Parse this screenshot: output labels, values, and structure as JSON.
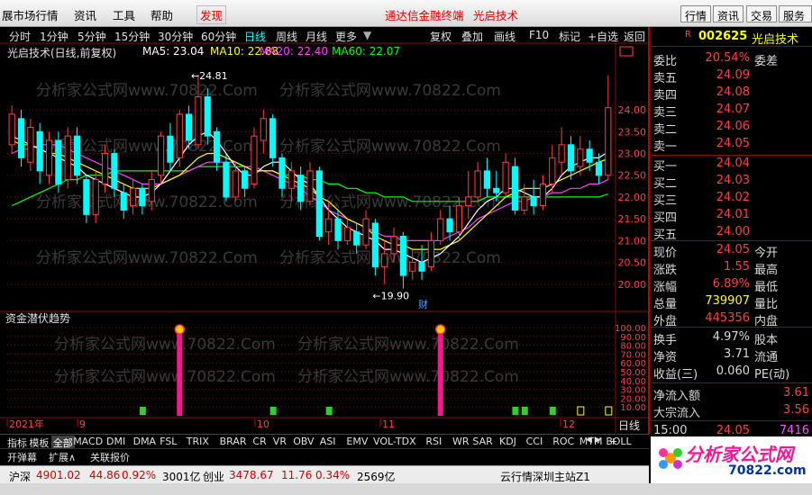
{
  "menu": {
    "items": [
      "展市场行情",
      "资讯",
      "工具",
      "帮助"
    ],
    "discover": "发现",
    "promo": [
      "通达信金融终端",
      "光启技术"
    ],
    "buttons": [
      "行情",
      "资讯",
      "交易"
    ],
    "more_btn": "服务"
  },
  "toolbar": {
    "periods": [
      "分时",
      "1分钟",
      "5分钟",
      "15分钟",
      "30分钟",
      "60分钟",
      "日线",
      "周线",
      "月线",
      "更多"
    ],
    "active": "日线",
    "tools": [
      "复权",
      "叠加",
      "画线",
      "F10",
      "标记",
      "+自选",
      "返回"
    ]
  },
  "chart_header": {
    "name": "光启技术(日线,前复权)",
    "ma5": "MA5: 23.04",
    "ma10": "MA10: 22.88",
    "ma20": "MA20: 22.40",
    "ma60": "MA60: 22.07"
  },
  "colors": {
    "up": "#ff4040",
    "down": "#00ffff",
    "ma5": "#ffffff",
    "ma10": "#ffff00",
    "ma20": "#ff40ff",
    "ma60": "#00ff00",
    "grid": "#801010",
    "indicator": "#ff1493"
  },
  "chart_data": {
    "type": "candlestick",
    "price_axis": [
      "24.00",
      "23.50",
      "23.00",
      "22.50",
      "22.00",
      "21.50",
      "21.00",
      "20.50",
      "20.00"
    ],
    "ylim": [
      19.5,
      25.2
    ],
    "high_label": "24.81",
    "low_label": "19.90",
    "event_marker": "财",
    "date_labels": [
      "2021年",
      "9",
      "10",
      "11",
      "12"
    ],
    "period_label": "日线",
    "candles": [
      [
        23.2,
        23.9,
        23.0,
        24.1
      ],
      [
        23.8,
        22.9,
        22.7,
        24.0
      ],
      [
        22.8,
        23.6,
        22.6,
        23.8
      ],
      [
        23.5,
        22.6,
        22.3,
        23.7
      ],
      [
        22.5,
        23.3,
        22.3,
        23.5
      ],
      [
        23.3,
        22.3,
        22.1,
        23.5
      ],
      [
        22.4,
        23.4,
        22.2,
        23.6
      ],
      [
        23.4,
        22.5,
        22.3,
        23.6
      ],
      [
        22.4,
        21.6,
        21.4,
        22.5
      ],
      [
        21.6,
        22.4,
        21.4,
        22.6
      ],
      [
        22.3,
        23.0,
        22.1,
        23.2
      ],
      [
        23.0,
        22.2,
        22.0,
        23.1
      ],
      [
        22.1,
        21.7,
        21.5,
        22.3
      ],
      [
        21.8,
        22.2,
        21.6,
        22.4
      ],
      [
        22.2,
        21.8,
        21.6,
        22.3
      ],
      [
        21.9,
        22.4,
        21.7,
        22.6
      ],
      [
        22.5,
        23.4,
        22.3,
        23.5
      ],
      [
        23.4,
        22.8,
        22.6,
        23.7
      ],
      [
        22.9,
        23.9,
        22.7,
        24.0
      ],
      [
        23.9,
        23.3,
        23.1,
        24.1
      ],
      [
        23.2,
        24.3,
        23.1,
        24.81
      ],
      [
        24.3,
        23.4,
        23.2,
        24.5
      ],
      [
        23.5,
        22.8,
        22.6,
        23.6
      ],
      [
        22.8,
        22.0,
        21.9,
        23.0
      ],
      [
        22.0,
        22.6,
        21.9,
        22.8
      ],
      [
        22.6,
        22.2,
        22.0,
        22.7
      ],
      [
        22.3,
        23.4,
        22.2,
        23.6
      ],
      [
        23.3,
        23.8,
        23.0,
        24.0
      ],
      [
        23.8,
        22.9,
        22.7,
        23.9
      ],
      [
        22.9,
        22.2,
        22.0,
        23.0
      ],
      [
        22.2,
        22.6,
        21.9,
        22.8
      ],
      [
        22.5,
        21.9,
        21.7,
        22.7
      ],
      [
        21.9,
        22.6,
        21.8,
        22.8
      ],
      [
        22.6,
        21.1,
        21.0,
        22.7
      ],
      [
        21.2,
        21.5,
        20.9,
        21.9
      ],
      [
        21.5,
        21.0,
        20.8,
        21.7
      ],
      [
        21.0,
        21.3,
        20.9,
        21.5
      ],
      [
        21.2,
        20.9,
        20.7,
        21.4
      ],
      [
        20.9,
        21.5,
        20.8,
        21.7
      ],
      [
        21.4,
        20.4,
        20.2,
        21.5
      ],
      [
        20.4,
        20.7,
        20.0,
        21.0
      ],
      [
        20.7,
        21.1,
        20.5,
        21.3
      ],
      [
        21.1,
        20.2,
        19.9,
        21.2
      ],
      [
        20.3,
        20.5,
        20.1,
        20.8
      ],
      [
        20.5,
        20.3,
        20.1,
        20.9
      ],
      [
        20.4,
        21.0,
        20.3,
        21.2
      ],
      [
        21.0,
        21.5,
        20.9,
        21.7
      ],
      [
        21.5,
        21.2,
        21.0,
        21.8
      ],
      [
        21.2,
        21.8,
        21.0,
        22.0
      ],
      [
        21.8,
        22.0,
        21.5,
        22.6
      ],
      [
        22.0,
        22.6,
        21.9,
        22.8
      ],
      [
        22.6,
        22.2,
        22.0,
        22.9
      ],
      [
        22.2,
        22.1,
        21.9,
        22.6
      ],
      [
        22.1,
        22.8,
        22.0,
        23.0
      ],
      [
        22.7,
        21.7,
        21.6,
        22.9
      ],
      [
        21.7,
        22.0,
        21.6,
        22.3
      ],
      [
        22.0,
        21.8,
        21.6,
        22.4
      ],
      [
        21.8,
        22.3,
        21.7,
        22.5
      ],
      [
        22.3,
        22.9,
        22.1,
        23.2
      ],
      [
        22.8,
        23.2,
        22.5,
        23.6
      ],
      [
        23.2,
        22.6,
        22.4,
        23.4
      ],
      [
        22.7,
        23.1,
        22.5,
        23.4
      ],
      [
        23.1,
        22.8,
        22.6,
        23.3
      ],
      [
        22.8,
        22.5,
        22.3,
        23.0
      ],
      [
        22.5,
        24.05,
        22.4,
        24.8
      ]
    ],
    "ma5": [
      23.4,
      23.3,
      23.2,
      23.1,
      23.0,
      22.9,
      22.8,
      22.7,
      22.5,
      22.4,
      22.3,
      22.2,
      22.1,
      22.0,
      22.0,
      22.1,
      22.3,
      22.6,
      22.9,
      23.2,
      23.4,
      23.5,
      23.3,
      23.0,
      22.7,
      22.5,
      22.5,
      22.7,
      22.8,
      22.8,
      22.6,
      22.4,
      22.3,
      22.0,
      21.7,
      21.5,
      21.3,
      21.2,
      21.1,
      21.0,
      20.8,
      20.8,
      20.7,
      20.6,
      20.5,
      20.6,
      20.7,
      20.9,
      21.1,
      21.4,
      21.7,
      21.9,
      22.0,
      22.2,
      22.2,
      22.1,
      22.0,
      22.0,
      22.2,
      22.5,
      22.7,
      22.8,
      22.9,
      22.9,
      23.04
    ],
    "ma10": [
      23.3,
      23.2,
      23.2,
      23.1,
      23.0,
      23.0,
      22.9,
      22.8,
      22.7,
      22.6,
      22.5,
      22.4,
      22.3,
      22.2,
      22.2,
      22.2,
      22.3,
      22.4,
      22.5,
      22.7,
      22.9,
      23.0,
      23.0,
      22.9,
      22.8,
      22.7,
      22.6,
      22.6,
      22.6,
      22.5,
      22.4,
      22.3,
      22.2,
      22.0,
      21.9,
      21.7,
      21.5,
      21.4,
      21.3,
      21.1,
      21.0,
      20.9,
      20.9,
      20.8,
      20.8,
      20.8,
      20.8,
      20.9,
      21.0,
      21.2,
      21.4,
      21.6,
      21.8,
      22.0,
      22.1,
      22.2,
      22.2,
      22.2,
      22.3,
      22.4,
      22.5,
      22.6,
      22.7,
      22.8,
      22.88
    ],
    "ma20": [
      23.0,
      23.1,
      23.1,
      23.2,
      23.2,
      23.2,
      23.1,
      23.0,
      22.9,
      22.8,
      22.7,
      22.6,
      22.5,
      22.4,
      22.3,
      22.3,
      22.3,
      22.4,
      22.5,
      22.6,
      22.7,
      22.8,
      22.8,
      22.8,
      22.8,
      22.7,
      22.7,
      22.6,
      22.5,
      22.4,
      22.3,
      22.2,
      22.0,
      21.9,
      21.7,
      21.6,
      21.5,
      21.4,
      21.3,
      21.2,
      21.1,
      21.1,
      21.0,
      21.0,
      21.0,
      21.0,
      21.0,
      21.1,
      21.2,
      21.3,
      21.5,
      21.6,
      21.7,
      21.8,
      21.9,
      21.9,
      22.0,
      22.0,
      22.1,
      22.1,
      22.2,
      22.2,
      22.3,
      22.3,
      22.4
    ],
    "ma60": [
      21.8,
      21.9,
      22.0,
      22.1,
      22.2,
      22.3,
      22.4,
      22.4,
      22.5,
      22.5,
      22.5,
      22.6,
      22.6,
      22.6,
      22.6,
      22.6,
      22.6,
      22.6,
      22.6,
      22.6,
      22.7,
      22.7,
      22.7,
      22.7,
      22.7,
      22.7,
      22.6,
      22.6,
      22.6,
      22.5,
      22.5,
      22.5,
      22.4,
      22.4,
      22.3,
      22.3,
      22.2,
      22.2,
      22.1,
      22.1,
      22.0,
      22.0,
      22.0,
      21.9,
      21.9,
      21.9,
      21.9,
      21.9,
      21.9,
      21.9,
      21.9,
      22.0,
      22.0,
      22.0,
      22.0,
      22.0,
      22.0,
      22.0,
      22.0,
      22.0,
      22.0,
      22.0,
      22.0,
      22.0,
      22.07
    ],
    "indicator": {
      "name": "资金潜伏趋势",
      "axis": [
        "100.00",
        "90.00",
        "80.00",
        "70.00",
        "60.00",
        "50.00",
        "40.00",
        "30.00",
        "20.00",
        "10.00"
      ],
      "spikes": [
        {
          "index": 18,
          "value": 100
        },
        {
          "index": 46,
          "value": 100
        }
      ],
      "green_markers": [
        14,
        28,
        34,
        54,
        55,
        58
      ],
      "yellow_markers": [
        61,
        64
      ]
    }
  },
  "right_panel": {
    "code": "002625",
    "name": "光启技术",
    "weibi_label": "委比",
    "weibi": "20.54%",
    "weicha_label": "委差",
    "asks": [
      [
        "卖五",
        "24.09"
      ],
      [
        "卖四",
        "24.08"
      ],
      [
        "卖三",
        "24.07"
      ],
      [
        "卖二",
        "24.06"
      ],
      [
        "卖一",
        "24.05"
      ]
    ],
    "bids": [
      [
        "买一",
        "24.04"
      ],
      [
        "买二",
        "24.03"
      ],
      [
        "买三",
        "24.02"
      ],
      [
        "买四",
        "24.01"
      ],
      [
        "买五",
        "24.00"
      ]
    ],
    "stats": [
      [
        "现价",
        "24.05",
        "今开"
      ],
      [
        "涨跌",
        "1.55",
        "最高"
      ],
      [
        "涨幅",
        "6.89%",
        "最低"
      ],
      [
        "总量",
        "739907",
        "量比"
      ],
      [
        "外盘",
        "445356",
        "内盘"
      ]
    ],
    "stats2": [
      [
        "换手",
        "4.97%",
        "股本"
      ],
      [
        "净资",
        "3.71",
        "流通"
      ],
      [
        "收益(三)",
        "0.060",
        "PE(动)"
      ]
    ],
    "flows": [
      [
        "净流入额",
        "3.61"
      ],
      [
        "大宗流入",
        "3.56"
      ]
    ],
    "time": "15:00",
    "tick_price": "24.05",
    "tick_vol": "7416"
  },
  "tabs": [
    "指标",
    "模板",
    "全部",
    "MACD",
    "DMI",
    "DMA",
    "FSL",
    "TRIX",
    "BRAR",
    "CR",
    "VR",
    "OBV",
    "ASI",
    "EMV",
    "VOL-TDX",
    "RSI",
    "WR",
    "SAR",
    "KDJ",
    "CCI",
    "ROC",
    "MTM",
    "BOLL"
  ],
  "subtabs": [
    "开弹幕",
    "扩展∧",
    "关联报价"
  ],
  "status": {
    "sh_name": "沪深",
    "sh_val": "4901.02",
    "sh_chg": "44.86",
    "sh_pct": "0.92%",
    "sh_amt": "3001亿",
    "cy_name": "创业",
    "cy_val": "3478.67",
    "cy_chg": "11.76",
    "cy_pct": "0.34%",
    "cy_amt": "2569亿",
    "server": "云行情深圳主站Z1"
  },
  "watermark": "分析家公式网www.70822.Com",
  "logo": {
    "title": "分析家公式网",
    "url": "70822.com"
  }
}
